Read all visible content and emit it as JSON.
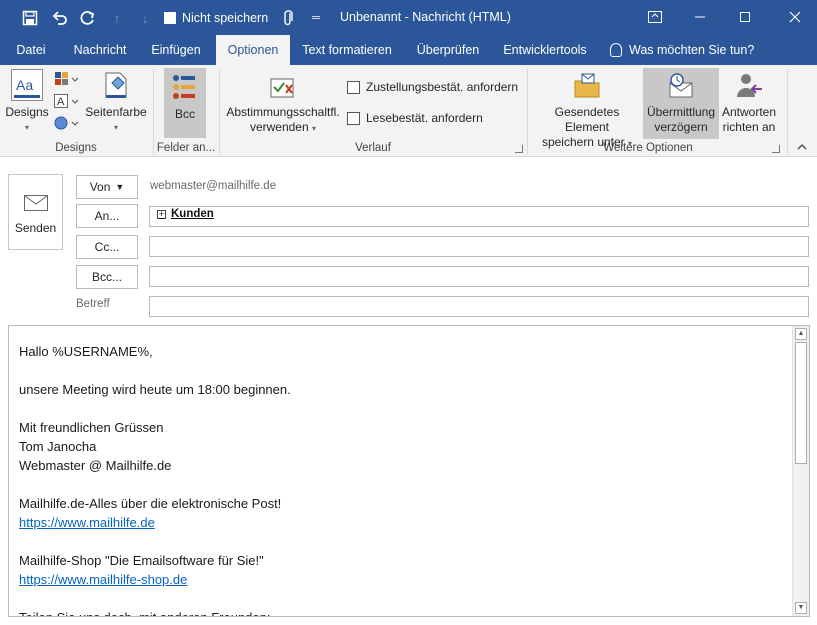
{
  "quick_access": {
    "dont_save_label": "Nicht speichern",
    "save_icon": "save-icon",
    "undo_icon": "undo-icon",
    "redo_icon": "redo-icon",
    "attach_icon": "paperclip-icon"
  },
  "window": {
    "title": "Unbenannt  -  Nachricht (HTML)"
  },
  "tabs": [
    {
      "label": "Datei"
    },
    {
      "label": "Nachricht"
    },
    {
      "label": "Einfügen"
    },
    {
      "label": "Optionen"
    },
    {
      "label": "Text formatieren"
    },
    {
      "label": "Überprüfen"
    },
    {
      "label": "Entwicklertools"
    }
  ],
  "active_tab": "Optionen",
  "tell_me": "Was möchten Sie tun?",
  "ribbon": {
    "designs": {
      "designs_label": "Designs",
      "page_color_label": "Seitenfarbe",
      "group_label": "Designs"
    },
    "fields": {
      "bcc_label": "Bcc",
      "group_label": "Felder an..."
    },
    "tracking": {
      "voting_label_1": "Abstimmungsschaltfl.",
      "voting_label_2": "verwenden",
      "delivery_receipt": "Zustellungsbestät. anfordern",
      "read_receipt": "Lesebestät. anfordern",
      "group_label": "Verlauf"
    },
    "more": {
      "save_sent_1": "Gesendetes Element",
      "save_sent_2": "speichern unter",
      "delay_1": "Übermittlung",
      "delay_2": "verzögern",
      "reply_1": "Antworten",
      "reply_2": "richten an",
      "group_label": "Weitere Optionen"
    }
  },
  "compose": {
    "send_label": "Senden",
    "from_label": "Von",
    "from_value": "webmaster@mailhilfe.de",
    "to_label": "An...",
    "to_value": "Kunden",
    "cc_label": "Cc...",
    "bcc_label": "Bcc...",
    "subject_label": "Betreff"
  },
  "body": {
    "lines": [
      "Hallo %USERNAME%,",
      "",
      "unsere Meeting wird heute um 18:00 beginnen.",
      "",
      "Mit freundlichen Grüssen",
      "Tom Janocha",
      "Webmaster @ Mailhilfe.de",
      "",
      "Mailhilfe.de-Alles über die elektronische Post!",
      "https://www.mailhilfe.de",
      "",
      "Mailhilfe-Shop \"Die Emailsoftware für Sie!\"",
      "https://www.mailhilfe-shop.de",
      "",
      "Teilen Sie uns doch, mit anderen Freunden:"
    ]
  },
  "colors": {
    "brand": "#2b579a",
    "ribbon_bg": "#f3f3f3",
    "link": "#0563c1"
  }
}
